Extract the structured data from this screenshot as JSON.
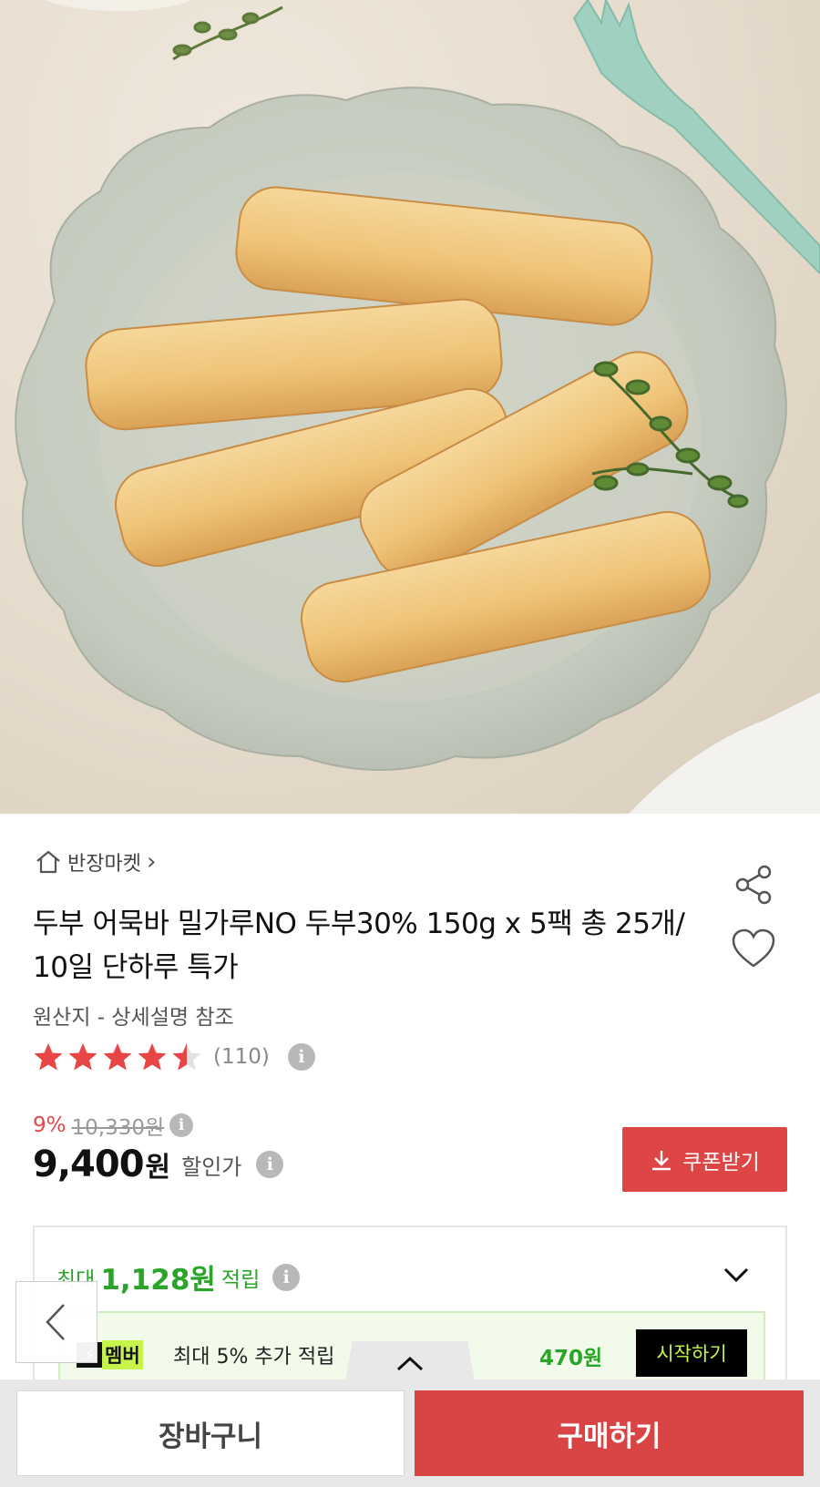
{
  "product_image": {
    "alt": "두부 어묵바"
  },
  "store": {
    "name": "반장마켓",
    "arrow": "›"
  },
  "product": {
    "title": "두부 어묵바 밀가루NO 두부30% 150g x 5팩 총 25개/ 10일 단하루 특가",
    "origin": "원산지 - 상세설명 참조"
  },
  "rating": {
    "score": 4.5,
    "max": 5,
    "count_text": "(110)"
  },
  "pricing": {
    "discount_rate": "9%",
    "original_price": "10,330원",
    "price": "9,400",
    "price_unit": "원",
    "price_label": "할인가",
    "coupon_label": "쿠폰받기"
  },
  "reward": {
    "prefix": "최대",
    "amount": "1,128원",
    "suffix": "적립",
    "member": {
      "badge_label": "멤버",
      "text": "최대 5% 추가 적립",
      "amount": "470원",
      "start_label": "시작하기"
    }
  },
  "bottom": {
    "cart_label": "장바구니",
    "buy_label": "구매하기"
  },
  "colors": {
    "accent_red": "#de4646",
    "reward_green": "#2aa52a",
    "member_lime": "#c7f44a"
  },
  "icons": [
    "home-icon",
    "share-icon",
    "heart-icon",
    "star-icon",
    "info-icon",
    "download-icon",
    "chevron-down-icon",
    "chevron-left-icon",
    "chevron-up-icon"
  ]
}
